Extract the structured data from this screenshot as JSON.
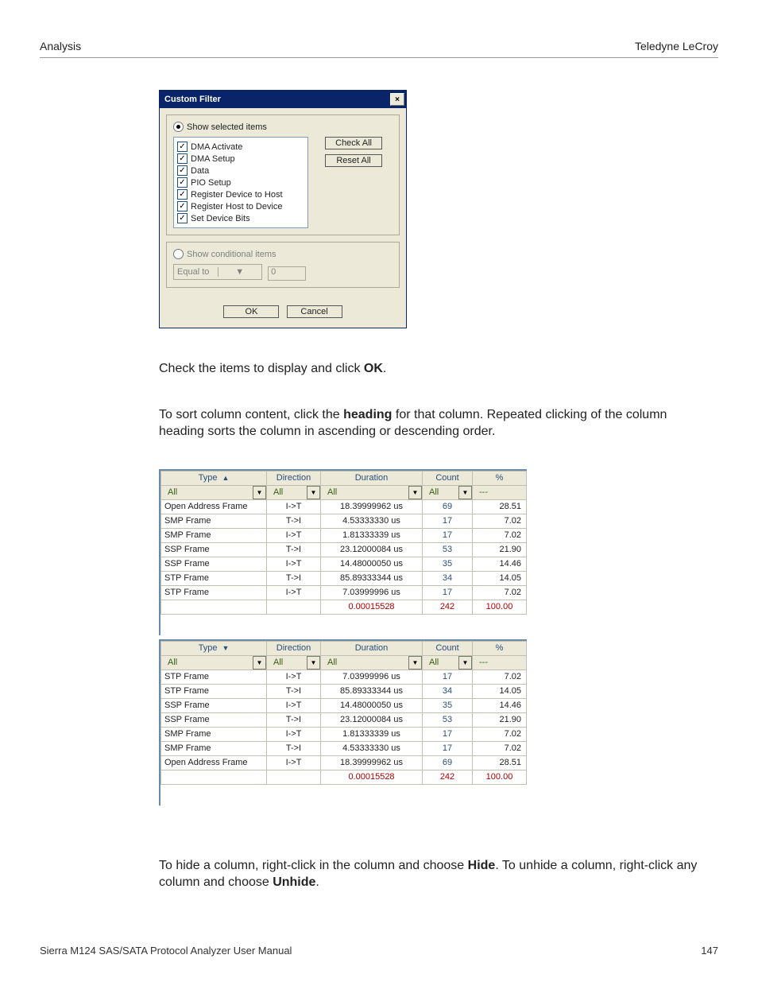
{
  "header": {
    "left": "Analysis",
    "right": "Teledyne LeCroy"
  },
  "dialog": {
    "title": "Custom Filter",
    "close_glyph": "×",
    "radio_show_selected": "Show selected items",
    "radio_show_conditional": "Show conditional items",
    "items": [
      "DMA Activate",
      "DMA Setup",
      "Data",
      "PIO Setup",
      "Register Device to Host",
      "Register Host to Device",
      "Set Device Bits"
    ],
    "check_all": "Check All",
    "reset_all": "Reset All",
    "cond_op": "Equal to",
    "cond_val": "0",
    "ok": "OK",
    "cancel": "Cancel"
  },
  "para1_a": "Check the items to display and click ",
  "para1_b": "OK",
  "para1_c": ".",
  "para2_a": "To sort column content, click the ",
  "para2_b": "heading",
  "para2_c": " for that column. Repeated clicking of the column heading sorts the column in ascending or descending order.",
  "para3_a": "To hide a column, right-click in the column and choose ",
  "para3_b": "Hide",
  "para3_c": ". To unhide a column, right-click any column and choose ",
  "para3_d": "Unhide",
  "para3_e": ".",
  "cols": {
    "type": "Type",
    "direction": "Direction",
    "duration": "Duration",
    "count": "Count",
    "pct": "%"
  },
  "filter_all": "All",
  "filter_dashes": "---",
  "sort_up": "▲",
  "sort_down": "▼",
  "dd_glyph": "▼",
  "table_asc": {
    "rows": [
      {
        "type": "Open Address Frame",
        "dir": "I->T",
        "dur": "18.39999962 us",
        "count": "69",
        "pct": "28.51"
      },
      {
        "type": "SMP Frame",
        "dir": "T->I",
        "dur": "4.53333330 us",
        "count": "17",
        "pct": "7.02"
      },
      {
        "type": "SMP Frame",
        "dir": "I->T",
        "dur": "1.81333339 us",
        "count": "17",
        "pct": "7.02"
      },
      {
        "type": "SSP Frame",
        "dir": "T->I",
        "dur": "23.12000084 us",
        "count": "53",
        "pct": "21.90"
      },
      {
        "type": "SSP Frame",
        "dir": "I->T",
        "dur": "14.48000050 us",
        "count": "35",
        "pct": "14.46"
      },
      {
        "type": "STP Frame",
        "dir": "T->I",
        "dur": "85.89333344 us",
        "count": "34",
        "pct": "14.05"
      },
      {
        "type": "STP Frame",
        "dir": "I->T",
        "dur": "7.03999996 us",
        "count": "17",
        "pct": "7.02"
      }
    ],
    "total": {
      "dur": "0.00015528",
      "count": "242",
      "pct": "100.00"
    }
  },
  "table_desc": {
    "rows": [
      {
        "type": "STP Frame",
        "dir": "I->T",
        "dur": "7.03999996 us",
        "count": "17",
        "pct": "7.02"
      },
      {
        "type": "STP Frame",
        "dir": "T->I",
        "dur": "85.89333344 us",
        "count": "34",
        "pct": "14.05"
      },
      {
        "type": "SSP Frame",
        "dir": "I->T",
        "dur": "14.48000050 us",
        "count": "35",
        "pct": "14.46"
      },
      {
        "type": "SSP Frame",
        "dir": "T->I",
        "dur": "23.12000084 us",
        "count": "53",
        "pct": "21.90"
      },
      {
        "type": "SMP Frame",
        "dir": "I->T",
        "dur": "1.81333339 us",
        "count": "17",
        "pct": "7.02"
      },
      {
        "type": "SMP Frame",
        "dir": "T->I",
        "dur": "4.53333330 us",
        "count": "17",
        "pct": "7.02"
      },
      {
        "type": "Open Address Frame",
        "dir": "I->T",
        "dur": "18.39999962 us",
        "count": "69",
        "pct": "28.51"
      }
    ],
    "total": {
      "dur": "0.00015528",
      "count": "242",
      "pct": "100.00"
    }
  },
  "footer": {
    "left": "Sierra M124 SAS/SATA Protocol Analyzer User Manual",
    "right": "147"
  }
}
